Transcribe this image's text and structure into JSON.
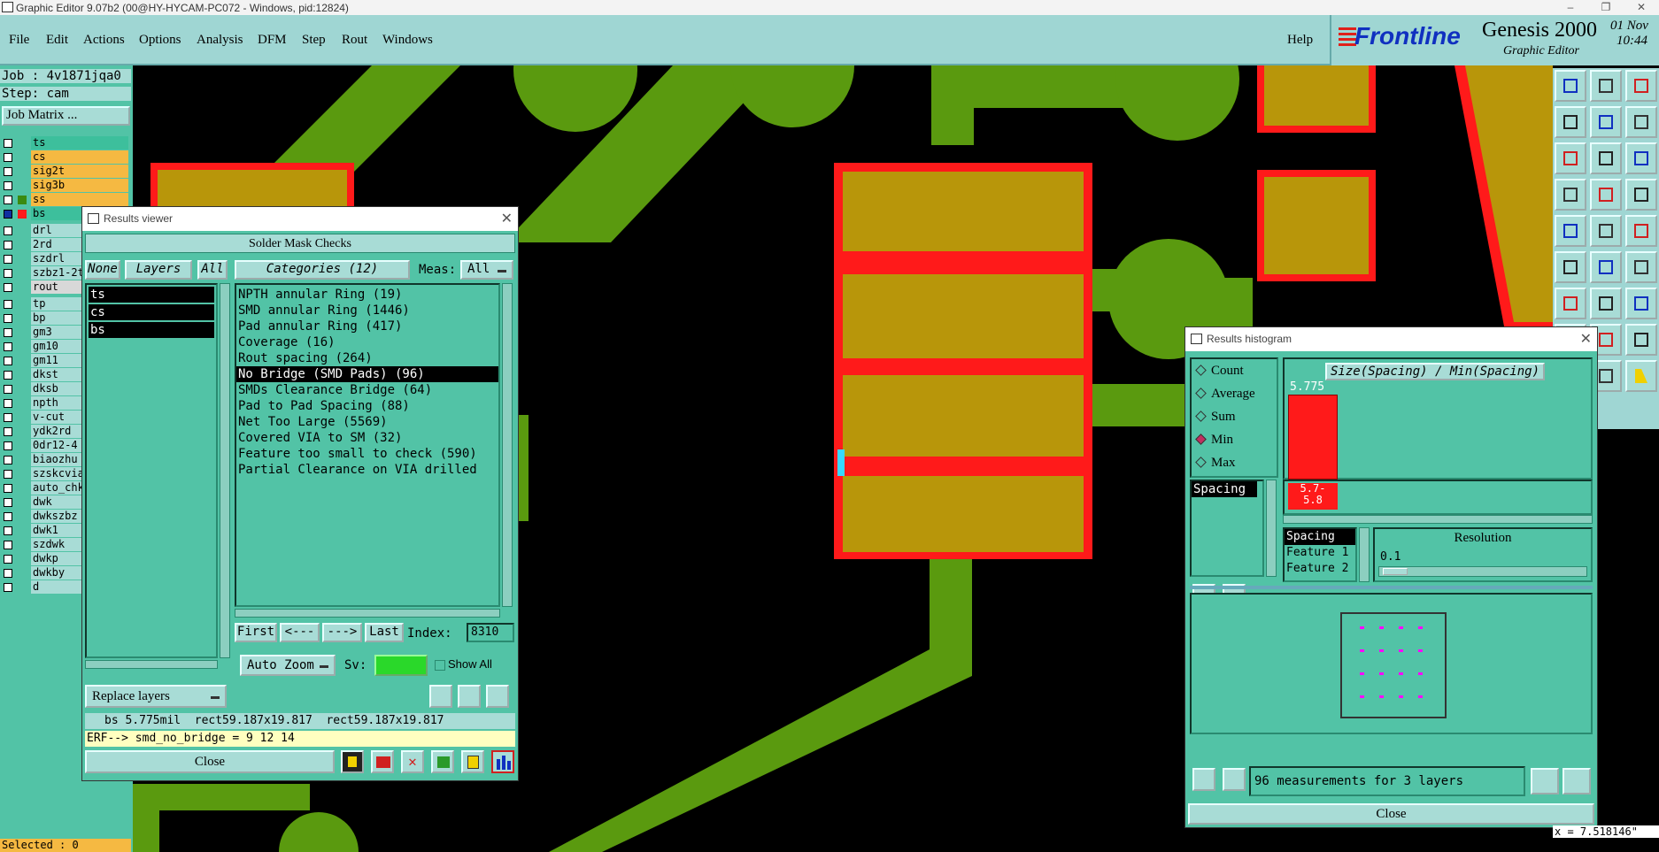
{
  "window": {
    "title": "Graphic Editor 9.07b2 (00@HY-HYCAM-PC072 - Windows, pid:12824)"
  },
  "menu": {
    "items": [
      "File",
      "Edit",
      "Actions",
      "Options",
      "Analysis",
      "DFM",
      "Step",
      "Rout",
      "Windows"
    ],
    "help": "Help"
  },
  "logo": {
    "brand": "Frontline",
    "product": "Genesis 2000",
    "subtitle": "Graphic Editor",
    "date": "01 Nov",
    "time": "10:44"
  },
  "left_panel": {
    "job": "Job : 4v1871jqa0",
    "step": "Step: cam",
    "job_matrix": "Job Matrix ...",
    "layers": [
      {
        "name": "ts",
        "color": "#3dbf9c"
      },
      {
        "name": "cs",
        "color": "#f5b942"
      },
      {
        "name": "sig2t",
        "color": "#f5b942"
      },
      {
        "name": "sig3b",
        "color": "#f5b942"
      },
      {
        "name": "ss",
        "color": "#f5b942"
      },
      {
        "name": "bs",
        "color": "#3dbf9c"
      },
      {
        "name": "drl",
        "color": "#a8dcd6"
      },
      {
        "name": "2rd",
        "color": "#a8dcd6"
      },
      {
        "name": "szdrl",
        "color": "#a8dcd6"
      },
      {
        "name": "szbz1-2t",
        "color": "#a8dcd6"
      },
      {
        "name": "rout",
        "color": "#d8d8d8"
      },
      {
        "name": "tp",
        "color": "#a8dcd6"
      },
      {
        "name": "bp",
        "color": "#a8dcd6"
      },
      {
        "name": "gm3",
        "color": "#a8dcd6"
      },
      {
        "name": "gm10",
        "color": "#a8dcd6"
      },
      {
        "name": "gm11",
        "color": "#a8dcd6"
      },
      {
        "name": "dkst",
        "color": "#a8dcd6"
      },
      {
        "name": "dksb",
        "color": "#a8dcd6"
      },
      {
        "name": "npth",
        "color": "#a8dcd6"
      },
      {
        "name": "v-cut",
        "color": "#a8dcd6"
      },
      {
        "name": "ydk2rd",
        "color": "#a8dcd6"
      },
      {
        "name": "0dr12-4",
        "color": "#a8dcd6"
      },
      {
        "name": "biaozhu",
        "color": "#a8dcd6"
      },
      {
        "name": "szskcvia",
        "color": "#a8dcd6"
      },
      {
        "name": "auto_chk",
        "color": "#a8dcd6"
      },
      {
        "name": "dwk",
        "color": "#a8dcd6"
      },
      {
        "name": "dwkszbz",
        "color": "#a8dcd6"
      },
      {
        "name": "dwk1",
        "color": "#a8dcd6"
      },
      {
        "name": "szdwk",
        "color": "#a8dcd6"
      },
      {
        "name": "dwkp",
        "color": "#a8dcd6"
      },
      {
        "name": "dwkby",
        "color": "#a8dcd6"
      },
      {
        "name": "d",
        "color": "#a8dcd6"
      }
    ],
    "selected": "Selected : 0"
  },
  "results_viewer": {
    "title": "Results viewer",
    "header": "Solder Mask Checks",
    "none_btn": "None",
    "layers_btn": "Layers",
    "all_btn": "All",
    "layer_list": [
      "ts",
      "cs",
      "bs"
    ],
    "categories_label": "Categories (12)",
    "meas_label": "Meas:",
    "meas_value": "All",
    "categories": [
      "NPTH annular Ring (19)",
      "SMD annular Ring (1446)",
      "Pad annular Ring (417)",
      "Coverage (16)",
      "Rout spacing (264)",
      "No Bridge (SMD Pads) (96)",
      "SMDs Clearance Bridge (64)",
      "Pad to Pad Spacing (88)",
      "Net Too Large (5569)",
      "Covered VIA to SM (32)",
      "Feature too small to check (590)",
      "Partial Clearance on VIA drilled"
    ],
    "selected_index": 5,
    "first": "First",
    "prev": "<---",
    "next": "--->",
    "last": "Last",
    "index_label": "Index:",
    "index_value": "8310",
    "auto_zoom": "Auto Zoom",
    "sv_label": "Sv:",
    "show_all": "Show All",
    "replace_layers": "Replace layers",
    "info": "bs 5.775mil  rect59.187x19.817  rect59.187x19.817",
    "erf": "ERF--> smd_no_bridge = 9 12 14",
    "close": "Close"
  },
  "results_histogram": {
    "title": "Results histogram",
    "options": [
      "Count",
      "Average",
      "Sum",
      "Min",
      "Max"
    ],
    "selected_option": "Min",
    "chart_title": "Size(Spacing) / Min(Spacing)",
    "bar_value": "5.775",
    "bar_range": "5.7-\n5.8",
    "measure_list": [
      "Spacing"
    ],
    "field_list": [
      "Spacing",
      "Feature 1",
      "Feature 2"
    ],
    "resolution_label": "Resolution",
    "resolution_value": "0.1",
    "status": "96 measurements for 3 layers",
    "close": "Close"
  },
  "coords": "x = 7.518146\""
}
